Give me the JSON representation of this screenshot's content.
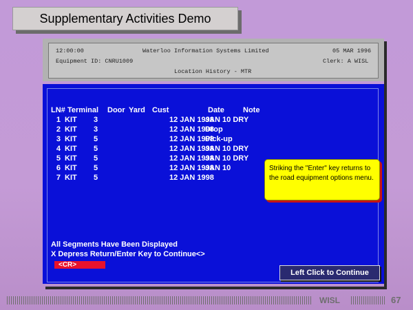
{
  "slide": {
    "title": "Supplementary Activities Demo",
    "page_number": "67",
    "footer_brand": "WISL"
  },
  "terminal_header": {
    "time": "12:00:00",
    "company": "Waterloo Information Systems Limited",
    "date": "05 MAR 1996",
    "equipment": "Equipment ID: CNRU1009",
    "clerk": "Clerk: A WISL",
    "screen_title": "Location History - MTR"
  },
  "table": {
    "headers": {
      "ln": "LN#",
      "terminal": "Terminal",
      "door": "Door",
      "yard": "Yard",
      "cust": "Cust",
      "date": "Date",
      "note": "Note"
    },
    "rows": [
      {
        "ln": "1",
        "terminal": "KIT",
        "door": "3",
        "date": "12 JAN 1998",
        "note": "JAN 10 DRY"
      },
      {
        "ln": "2",
        "terminal": "KIT",
        "door": "3",
        "date": "12 JAN 1998",
        "note": "Drop"
      },
      {
        "ln": "3",
        "terminal": "KIT",
        "door": "5",
        "date": "12 JAN 1998",
        "note": "Pick-up"
      },
      {
        "ln": "4",
        "terminal": "KIT",
        "door": "5",
        "date": "12 JAN 1998",
        "note": "JAN 10 DRY"
      },
      {
        "ln": "5",
        "terminal": "KIT",
        "door": "5",
        "date": "12 JAN 1998",
        "note": "JAN 10 DRY"
      },
      {
        "ln": "6",
        "terminal": "KIT",
        "door": "5",
        "date": "12 JAN 1998",
        "note": "JAN 10"
      },
      {
        "ln": "7",
        "terminal": "KIT",
        "door": "5",
        "date": "12 JAN 1998",
        "note": ""
      }
    ]
  },
  "messages": {
    "segments": "All Segments Have Been Displayed",
    "prompt": "X Depress Return/Enter Key to Continue<>",
    "cr": "<CR>"
  },
  "callout": {
    "text": "Striking the \"Enter\" key returns to the road equipment options menu."
  },
  "continue_button": {
    "label": "Left Click to Continue"
  },
  "colors": {
    "terminal_bg": "#0a10d8",
    "callout_bg": "#ffff00",
    "cr_bar": "#e8122c",
    "slide_bg": "#c29ad8"
  }
}
